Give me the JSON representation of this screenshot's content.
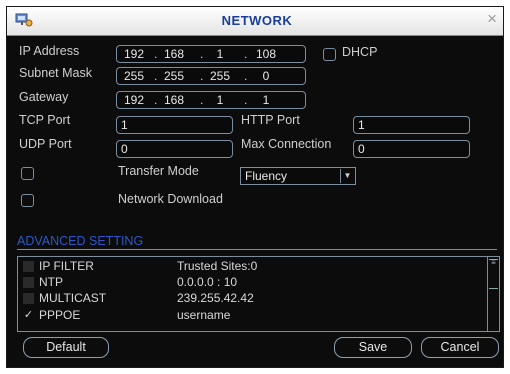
{
  "window": {
    "title": "NETWORK",
    "close_label": "×"
  },
  "fields": {
    "ip_address": {
      "label": "IP Address",
      "segments": [
        "192",
        "168",
        "1",
        "108"
      ]
    },
    "subnet_mask": {
      "label": "Subnet Mask",
      "segments": [
        "255",
        "255",
        "255",
        "0"
      ]
    },
    "gateway": {
      "label": "Gateway",
      "segments": [
        "192",
        "168",
        "1",
        "1"
      ]
    },
    "dhcp": {
      "label": "DHCP",
      "checked": false
    },
    "tcp_port": {
      "label": "TCP Port",
      "value": "1"
    },
    "http_port": {
      "label": "HTTP Port",
      "value": "1"
    },
    "udp_port": {
      "label": "UDP Port",
      "value": "0"
    },
    "max_connection": {
      "label": "Max Connection",
      "value": "0"
    },
    "transfer_mode": {
      "label": "Transfer Mode",
      "value": "Fluency",
      "checked": false
    },
    "network_download": {
      "label": "Network Download",
      "checked": false
    }
  },
  "advanced": {
    "title": "ADVANCED SETTING",
    "rows": [
      {
        "name": "IP FILTER",
        "value": "Trusted Sites:0",
        "checked": false
      },
      {
        "name": "NTP",
        "value": "0.0.0.0 : 10",
        "checked": false
      },
      {
        "name": "MULTICAST",
        "value": "239.255.42.42",
        "checked": false
      },
      {
        "name": "PPPOE",
        "value": "username",
        "checked": true
      }
    ]
  },
  "buttons": {
    "default": "Default",
    "save": "Save",
    "cancel": "Cancel"
  },
  "colors": {
    "background": "#0c0c0c",
    "accent": "#2f56c6",
    "title": "#1a3f9a",
    "border": "#7a8ea0"
  }
}
